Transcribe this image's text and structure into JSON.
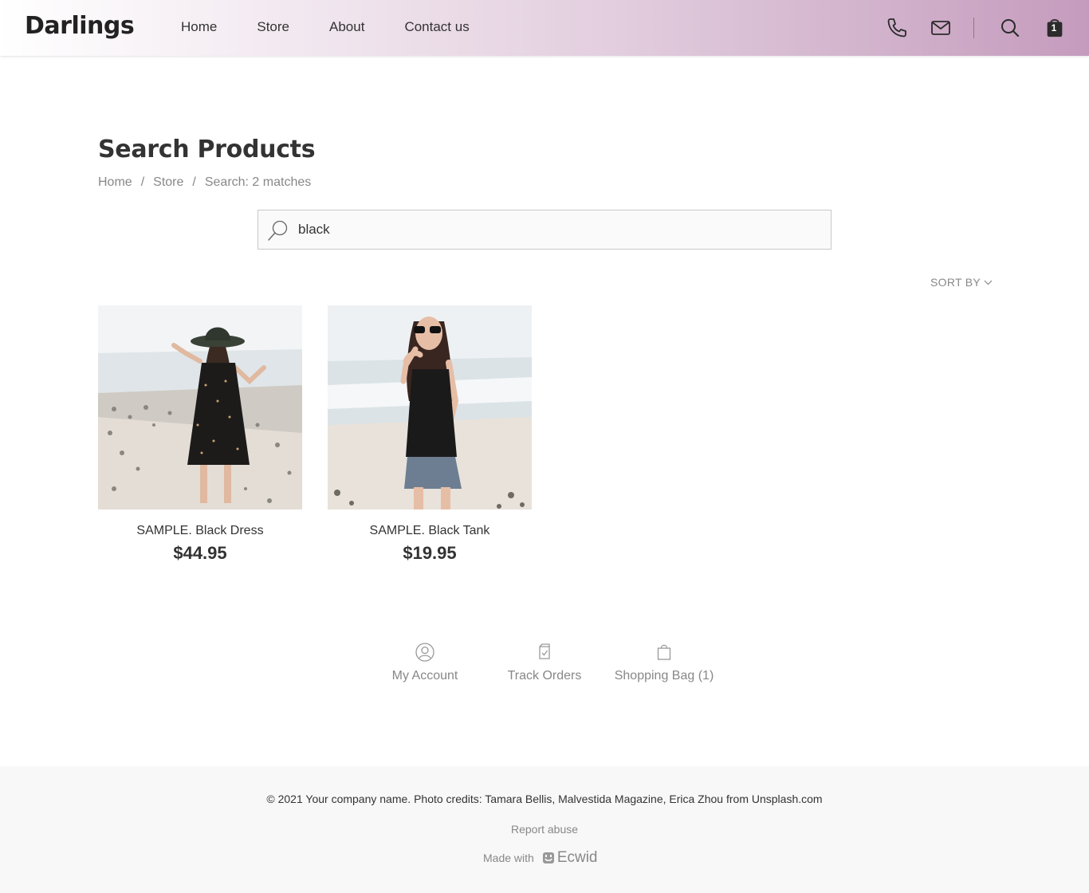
{
  "header": {
    "logo": "Darlings",
    "nav": [
      "Home",
      "Store",
      "About",
      "Contact us"
    ],
    "cart_count": "1"
  },
  "main": {
    "title": "Search Products",
    "breadcrumb": [
      "Home",
      "Store",
      "Search: 2 matches"
    ],
    "search": {
      "value": "black"
    },
    "sort_label": "SORT BY",
    "products": [
      {
        "name": "SAMPLE. Black Dress",
        "price": "$44.95"
      },
      {
        "name": "SAMPLE. Black Tank",
        "price": "$19.95"
      }
    ],
    "account_links": [
      {
        "label": "My Account",
        "icon": "user-icon"
      },
      {
        "label": "Track Orders",
        "icon": "track-orders-icon"
      },
      {
        "label": "Shopping Bag (1)",
        "icon": "shopping-bag-icon"
      }
    ]
  },
  "footer": {
    "credits": "© 2021 Your company name. Photo credits: Tamara Bellis, Malvestida Magazine, Erica Zhou from Unsplash.com",
    "report": "Report abuse",
    "made_with": "Made with",
    "brand": "Ecwid"
  }
}
